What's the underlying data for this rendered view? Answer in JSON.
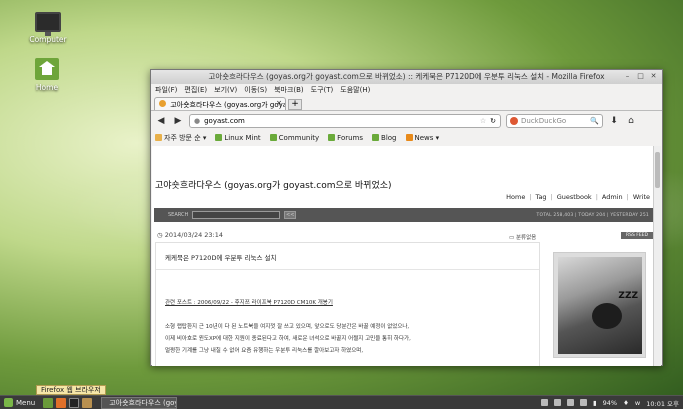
{
  "desktop": {
    "icons": [
      {
        "label": "Computer"
      },
      {
        "label": "Home"
      }
    ]
  },
  "window": {
    "title": "고아숏흐라다우스 (goyas.org가 goyast.com으로 바뀌었소) :: 케케묵은 P7120D에 우분투 리눅스 설치 - Mozilla Firefox",
    "menu": [
      "파일(F)",
      "편집(E)",
      "보기(V)",
      "이동(S)",
      "북마크(B)",
      "도구(T)",
      "도움말(H)"
    ],
    "tab": {
      "label": "고아숏흐라다우스 (goyas.org가 goyast..."
    },
    "newtab_label": "+",
    "url": "goyast.com",
    "search_placeholder": "DuckDuckGo",
    "bookmarks": [
      {
        "label": "자주 방문 순 ▾",
        "icon": "folder-icon"
      },
      {
        "label": "Linux Mint",
        "icon": "mint-favicon"
      },
      {
        "label": "Community",
        "icon": "mint-favicon"
      },
      {
        "label": "Forums",
        "icon": "mint-favicon"
      },
      {
        "label": "Blog",
        "icon": "mint-favicon"
      },
      {
        "label": "News ▾",
        "icon": "rss-icon"
      }
    ]
  },
  "page": {
    "site_title": "고야숏흐라다우스 (goyas.org가 goyast.com으로 바뀌었소)",
    "nav": [
      "Home",
      "Tag",
      "Guestbook",
      "Admin",
      "Write"
    ],
    "search_label": "SEARCH",
    "search_go": "<<",
    "stats": "TOTAL 258,403 | TODAY 204 | YESTERDAY 251",
    "post": {
      "date": "2014/03/24 23:14",
      "category": "분류없음",
      "rss": "RSS FEED",
      "title": "케케묵은 P7120D에 우분투 리눅스 설치",
      "related": "관련 포스트 : 2006/09/22 - 후지쯔 라이프북 P7120D CM10K 개봉기",
      "lines": [
        "소형 랩탑환지 근 10년이 다 된 노트북을 여지껏 잘 쓰고 있으며, 앞으로도 당분간은 바꿀 예정이 없었으나,",
        "이제 비아호로 윈도XP에 대한 지원이 종료된다고 하여, 새로운 녀석으로 바꿀지 어쩔지 고민을 통히 하다가,",
        "멀쩡한 기계를 그냥 내칠 수 없어 요즘 유행하는 우분투 리눅스를 깔아보고자 하였으며,"
      ]
    },
    "photo_text": "ZZZ"
  },
  "tooltip": "Firefox 웹 브라우저",
  "taskbar": {
    "menu_label": "Menu",
    "task_label": "고아숏흐라다우스 (goy",
    "battery": "94%",
    "clock": "10:01 오후"
  }
}
